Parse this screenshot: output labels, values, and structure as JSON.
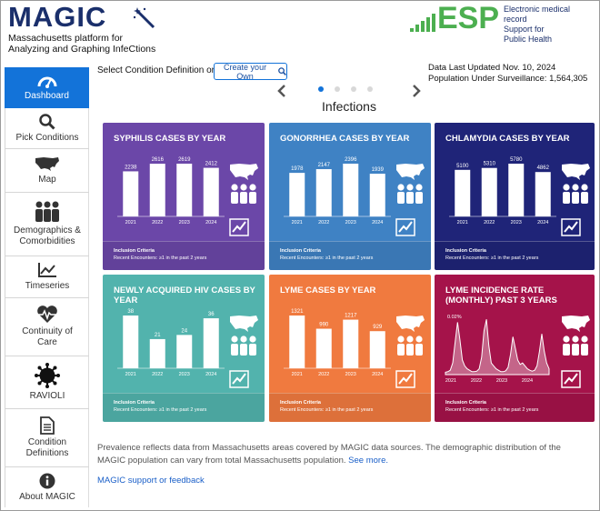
{
  "header": {
    "logo_text": "MAGIC",
    "subtitle_line1": "Massachusetts platform for",
    "subtitle_line2": "Analyzing and Graphing InfeCtions",
    "esp_logo": "ESP",
    "esp_line1": "Electronic medical record",
    "esp_line2": "Support for",
    "esp_line3": "Public Health"
  },
  "sidebar": {
    "items": [
      {
        "label": "Dashboard",
        "icon": "gauge-icon"
      },
      {
        "label": "Pick Conditions",
        "icon": "search-icon"
      },
      {
        "label": "Map",
        "icon": "us-map-icon"
      },
      {
        "label": "Demographics & Comorbidities",
        "icon": "people-icon"
      },
      {
        "label": "Timeseries",
        "icon": "line-chart-icon"
      },
      {
        "label": "Continuity of Care",
        "icon": "heartbeat-icon"
      },
      {
        "label": "RAVIOLI",
        "icon": "virus-icon"
      },
      {
        "label": "Condition Definitions",
        "icon": "document-icon"
      },
      {
        "label": "About MAGIC",
        "icon": "info-icon"
      }
    ],
    "active": "Dashboard"
  },
  "controls": {
    "select_label": "Select Condition Definition or",
    "create_button": "Create your Own",
    "updated": "Data Last Updated Nov. 10, 2024",
    "population": "Population Under Surveillance: 1,564,305"
  },
  "section_title": "Infections",
  "carousel": {
    "pages": 4,
    "current": 1
  },
  "colors": {
    "syphilis": "#6b47a8",
    "gonorrhea": "#3f82c4",
    "chlamydia": "#1f2478",
    "hiv": "#52b3ad",
    "lyme": "#f07a3f",
    "lyme_rate": "#a5134a",
    "accent": "#1373d9"
  },
  "footer_label": "Inclusion Criteria",
  "footer_text": "Recent Encounters: ≥1 in the past 2 years",
  "chart_data": [
    {
      "type": "bar",
      "title": "SYPHILIS CASES BY YEAR",
      "categories": [
        "2021",
        "2022",
        "2023",
        "2024"
      ],
      "values": [
        2238,
        2616,
        2619,
        2412
      ]
    },
    {
      "type": "bar",
      "title": "GONORRHEA CASES BY YEAR",
      "categories": [
        "2021",
        "2022",
        "2023",
        "2024"
      ],
      "values": [
        1978,
        2147,
        2396,
        1939
      ]
    },
    {
      "type": "bar",
      "title": "CHLAMYDIA CASES BY YEAR",
      "categories": [
        "2021",
        "2022",
        "2023",
        "2024"
      ],
      "values": [
        5100,
        5310,
        5780,
        4862
      ]
    },
    {
      "type": "bar",
      "title": "NEWLY ACQUIRED HIV CASES BY YEAR",
      "categories": [
        "2021",
        "2022",
        "2023",
        "2024"
      ],
      "values": [
        38,
        21,
        24,
        36
      ]
    },
    {
      "type": "bar",
      "title": "LYME CASES BY YEAR",
      "categories": [
        "2021",
        "2022",
        "2023",
        "2024"
      ],
      "values": [
        1321,
        990,
        1217,
        929
      ]
    },
    {
      "type": "area",
      "title": "LYME INCIDENCE RATE (MONTHLY) PAST 3 YEARS",
      "ymax_label": "0.02%",
      "x_labels": [
        "2021",
        "2022",
        "2023",
        "2024"
      ],
      "values": [
        0.0008,
        0.001,
        0.0015,
        0.004,
        0.011,
        0.018,
        0.012,
        0.005,
        0.003,
        0.002,
        0.0015,
        0.001,
        0.001,
        0.0012,
        0.002,
        0.006,
        0.015,
        0.019,
        0.01,
        0.004,
        0.003,
        0.002,
        0.0015,
        0.001,
        0.001,
        0.0013,
        0.0025,
        0.007,
        0.013,
        0.009,
        0.005,
        0.0035,
        0.004,
        0.003,
        0.002,
        0.0015,
        0.0012,
        0.0015,
        0.003,
        0.008,
        0.014,
        0.008,
        0.004,
        0.002
      ]
    }
  ],
  "note": {
    "text": "Prevalence reflects data from Massachusetts areas covered by MAGIC data sources. The demographic distribution of the MAGIC population can vary from total Massachusetts population.",
    "link": "See more."
  },
  "support_link": "MAGIC support or feedback"
}
